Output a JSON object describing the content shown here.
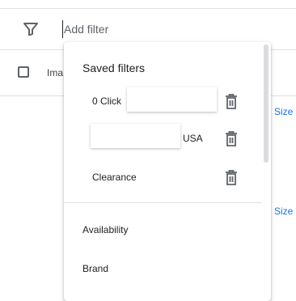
{
  "filter_bar": {
    "placeholder": "Add filter",
    "icon": "filter-icon"
  },
  "table": {
    "column_header": "Ima",
    "row_links": [
      "Size",
      "Size"
    ]
  },
  "menu": {
    "section_title": "Saved filters",
    "saved_filters": [
      {
        "prefix": "0 Click",
        "suffix": ""
      },
      {
        "prefix": "",
        "suffix": "USA"
      },
      {
        "prefix": "Clearance",
        "suffix": ""
      }
    ],
    "options": [
      "Availability",
      "Brand"
    ]
  },
  "colors": {
    "link": "#1a73e8",
    "divider": "#e0e0e0",
    "icon": "#5f6368"
  }
}
